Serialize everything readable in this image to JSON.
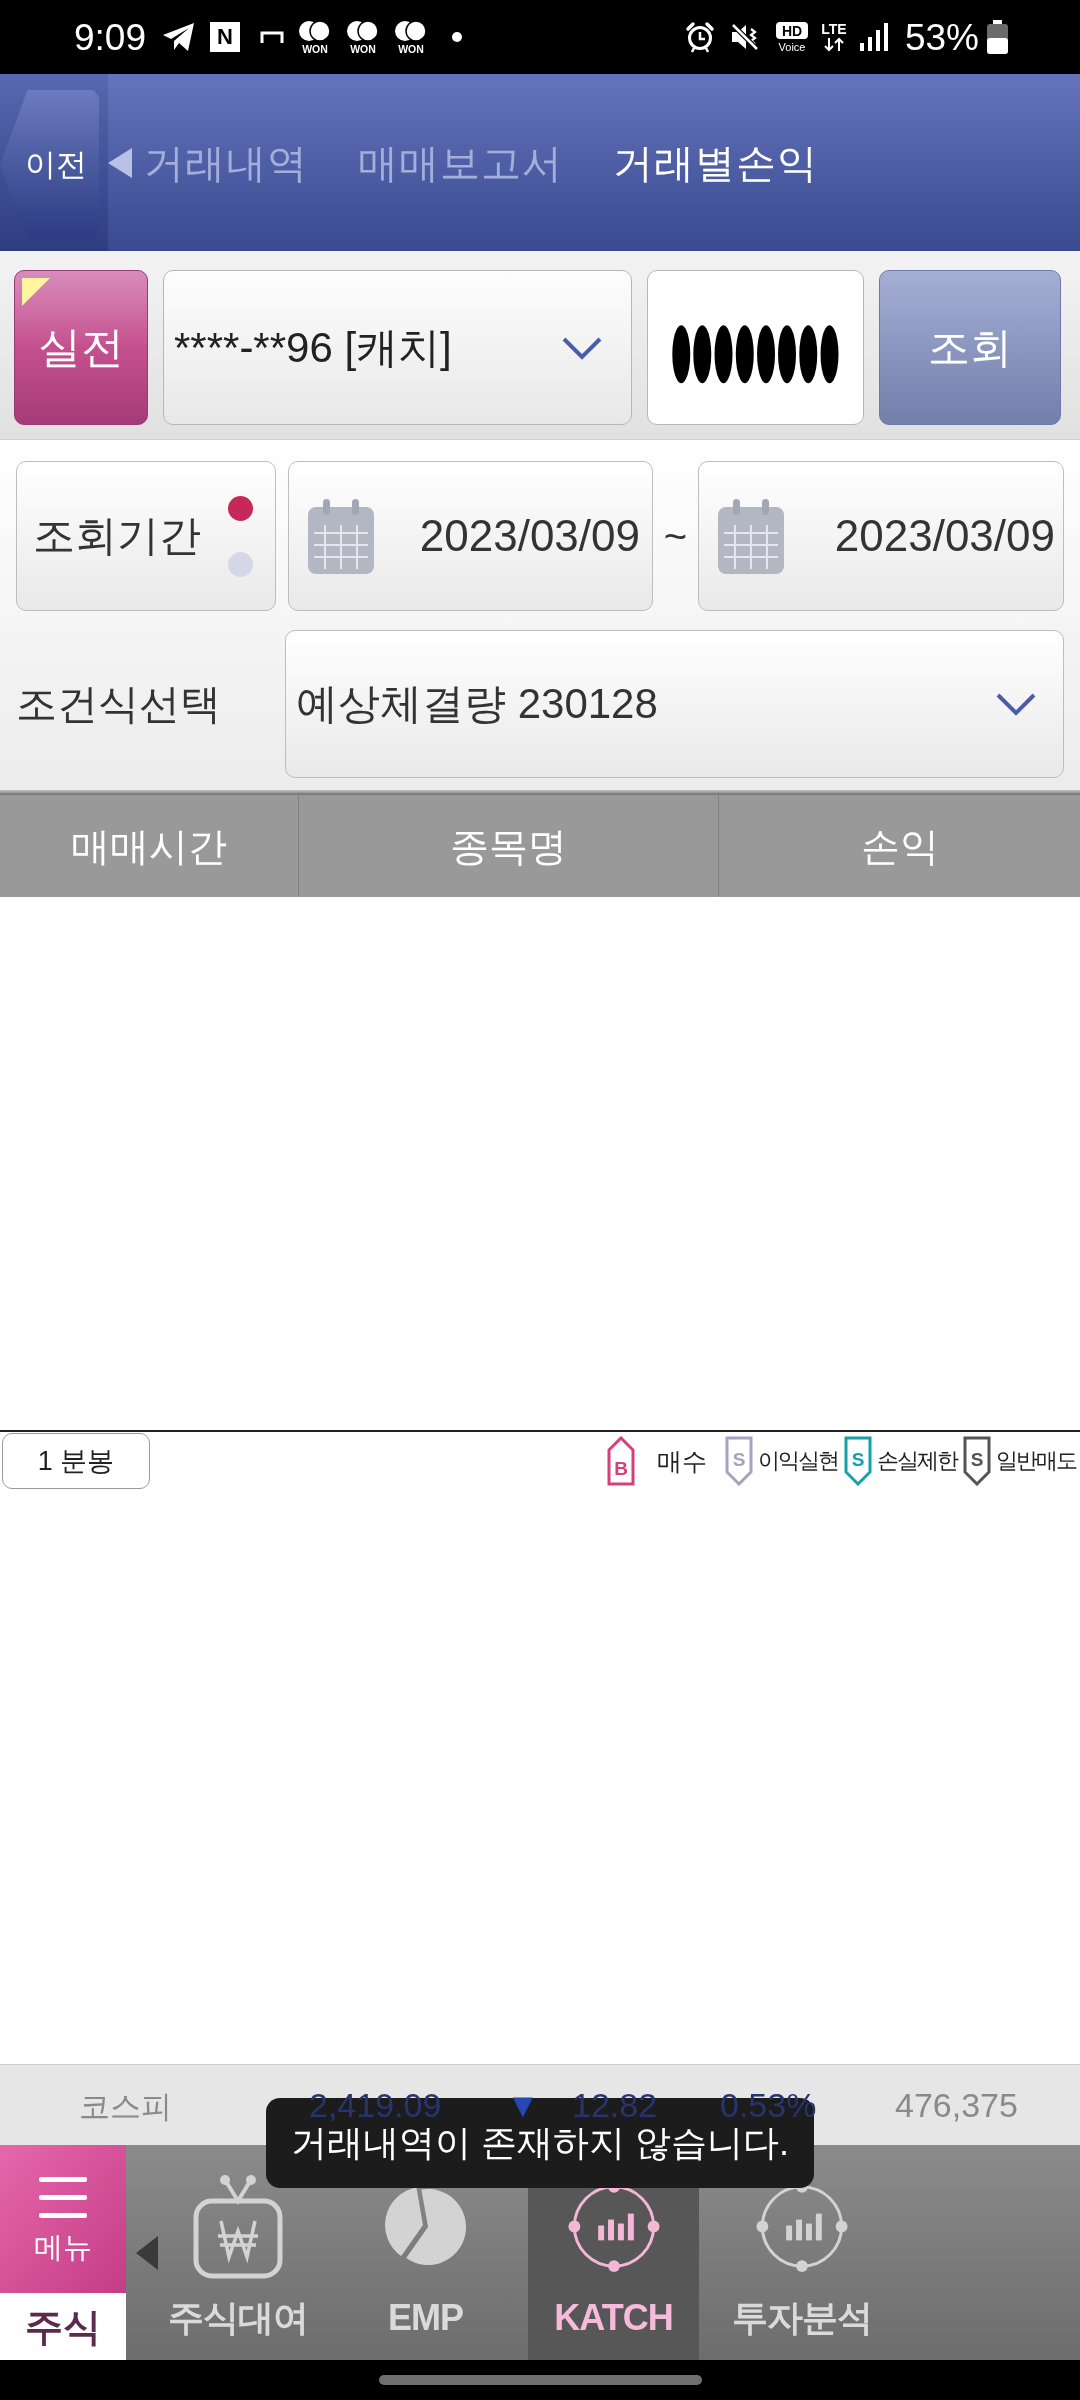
{
  "status_bar": {
    "time": "9:09",
    "notifications": [
      {
        "kind": "telegram"
      },
      {
        "kind": "letter_tile",
        "text": "N"
      },
      {
        "kind": "bracket"
      },
      {
        "kind": "won",
        "text": "WON"
      },
      {
        "kind": "won",
        "text": "WON"
      },
      {
        "kind": "won",
        "text": "WON"
      },
      {
        "kind": "dot"
      }
    ],
    "indicators": [
      {
        "kind": "alarm"
      },
      {
        "kind": "mute"
      },
      {
        "kind": "hd_voice",
        "text": "HD",
        "subtext": "Voice"
      },
      {
        "kind": "lte",
        "text": "LTE"
      },
      {
        "kind": "signal"
      }
    ],
    "battery_text": "53%"
  },
  "header": {
    "back_button": "이전",
    "tabs": [
      {
        "kind": "previous",
        "label": "거래내역",
        "selected": false
      },
      {
        "kind": "plain",
        "label": "매매보고서",
        "selected": false
      },
      {
        "kind": "plain",
        "label": "거래별손익",
        "selected": true
      }
    ]
  },
  "account_bar": {
    "mode_button": "실전",
    "account": {
      "value": "****-**96 [캐치]"
    },
    "password": {
      "value": "●●●●●●●●"
    },
    "search_button": "조회"
  },
  "filters": {
    "period": {
      "label": "조회기간",
      "dots": [
        {
          "selected": true
        },
        {
          "selected": false
        }
      ],
      "start_date": "2023/03/09",
      "separator": "~",
      "end_date": "2023/03/09"
    },
    "condition": {
      "label": "조건식선택",
      "value": "예상체결량 230128"
    }
  },
  "table": {
    "columns": [
      "매매시간",
      "종목명",
      "손익"
    ]
  },
  "chart_toolbar": {
    "interval_button": "1 분봉",
    "legend": [
      {
        "kind": "buy",
        "letter": "B",
        "label": "매수",
        "color": "#d6407a"
      },
      {
        "kind": "sell",
        "letter": "S",
        "label": "이익실현",
        "color": "#a4a4bf"
      },
      {
        "kind": "sell",
        "letter": "S",
        "label": "손실제한",
        "color": "#17a2a8"
      },
      {
        "kind": "sell",
        "letter": "S",
        "label": "일반매도",
        "color": "#555555"
      }
    ]
  },
  "ticker": {
    "name": "코스피",
    "value": "2,419.09",
    "direction": "▼",
    "change": "12.82",
    "rate": "0.53%",
    "volume": "476,375"
  },
  "toast": "거래내역이 존재하지 않습니다.",
  "bottom_nav": {
    "menu": {
      "label": "메뉴",
      "category": "주식"
    },
    "items": [
      {
        "kind": "tv_won",
        "label": "주식대여",
        "selected": false
      },
      {
        "kind": "pie",
        "label": "EMP",
        "selected": false
      },
      {
        "kind": "orbit_bars",
        "label": "KATCH",
        "selected": true
      },
      {
        "kind": "orbit_bars",
        "label": "투자분석",
        "selected": false
      }
    ]
  }
}
